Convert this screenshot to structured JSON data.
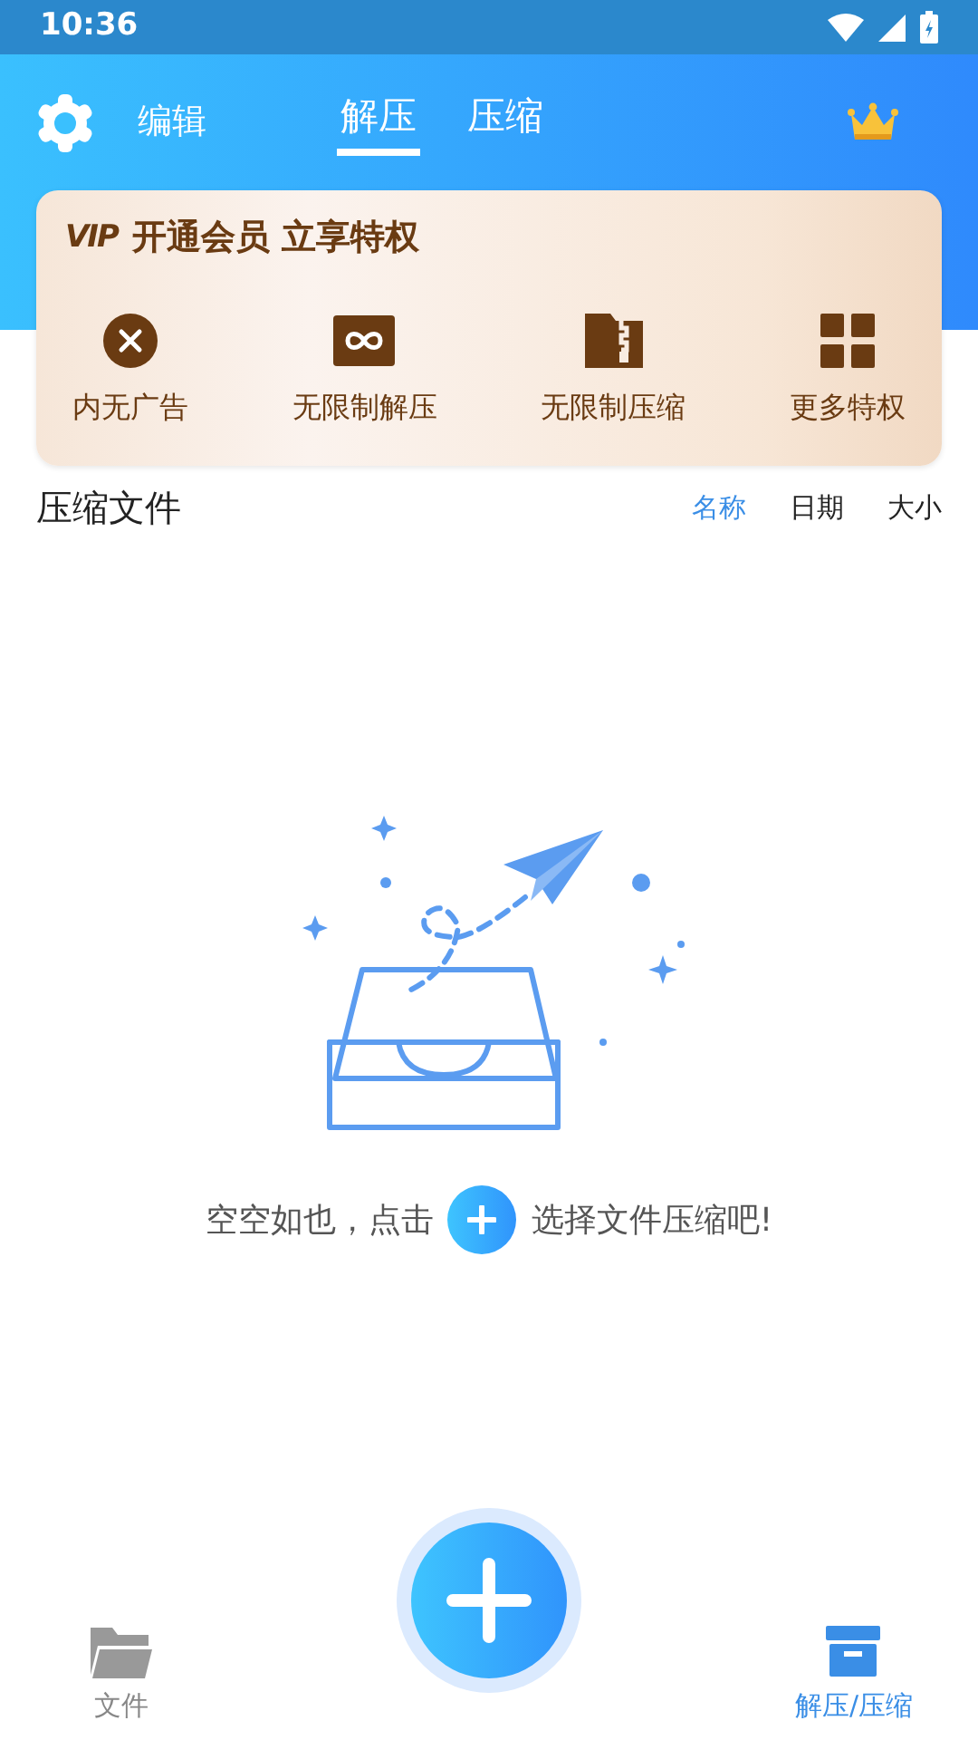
{
  "status_bar": {
    "time": "10:36"
  },
  "header": {
    "edit_label": "编辑",
    "tabs": [
      {
        "label": "解压",
        "selected": true
      },
      {
        "label": "压缩",
        "selected": false
      }
    ]
  },
  "vip_banner": {
    "logo": "VIP",
    "title": "开通会员 立享特权",
    "perks": [
      {
        "kind": "no-ads",
        "label": "内无广告"
      },
      {
        "kind": "unlimited-extract",
        "label": "无限制解压"
      },
      {
        "kind": "unlimited-compress",
        "label": "无限制压缩"
      },
      {
        "kind": "more",
        "label": "更多特权"
      }
    ]
  },
  "file_list": {
    "title": "压缩文件",
    "sort_options": [
      {
        "label": "名称",
        "selected": true
      },
      {
        "label": "日期",
        "selected": false
      },
      {
        "label": "大小",
        "selected": false
      }
    ]
  },
  "empty_state": {
    "text_before": "空空如也，点击",
    "text_after": "选择文件压缩吧!"
  },
  "bottom_nav": [
    {
      "kind": "files",
      "label": "文件",
      "selected": false
    },
    {
      "kind": "archive",
      "label": "解压/压缩",
      "selected": true
    }
  ]
}
